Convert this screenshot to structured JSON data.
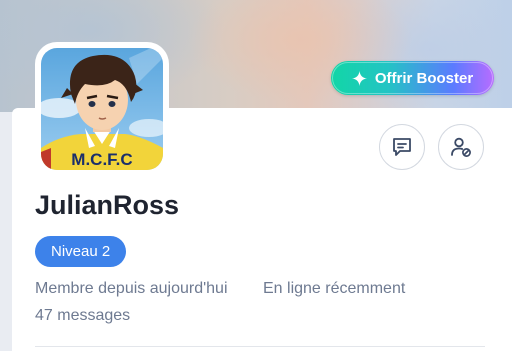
{
  "profile": {
    "username": "JulianRoss",
    "level_badge": "Niveau 2",
    "member_since": "Membre depuis aujourd'hui",
    "online_status": "En ligne récemment",
    "messages_count": "47 messages",
    "avatar_shirt_text": "M.C.F.C"
  },
  "actions": {
    "booster_label": "Offrir Booster",
    "booster_icon": "sparkle-icon",
    "message_icon": "chat-bubble-icon",
    "block_icon": "user-blocked-icon"
  },
  "colors": {
    "badge": "#3d82ea",
    "booster_gradient": [
      "#12d6a6",
      "#5b7bff",
      "#b86cff"
    ],
    "text_primary": "#1f2430",
    "text_secondary": "#6e7a91"
  }
}
